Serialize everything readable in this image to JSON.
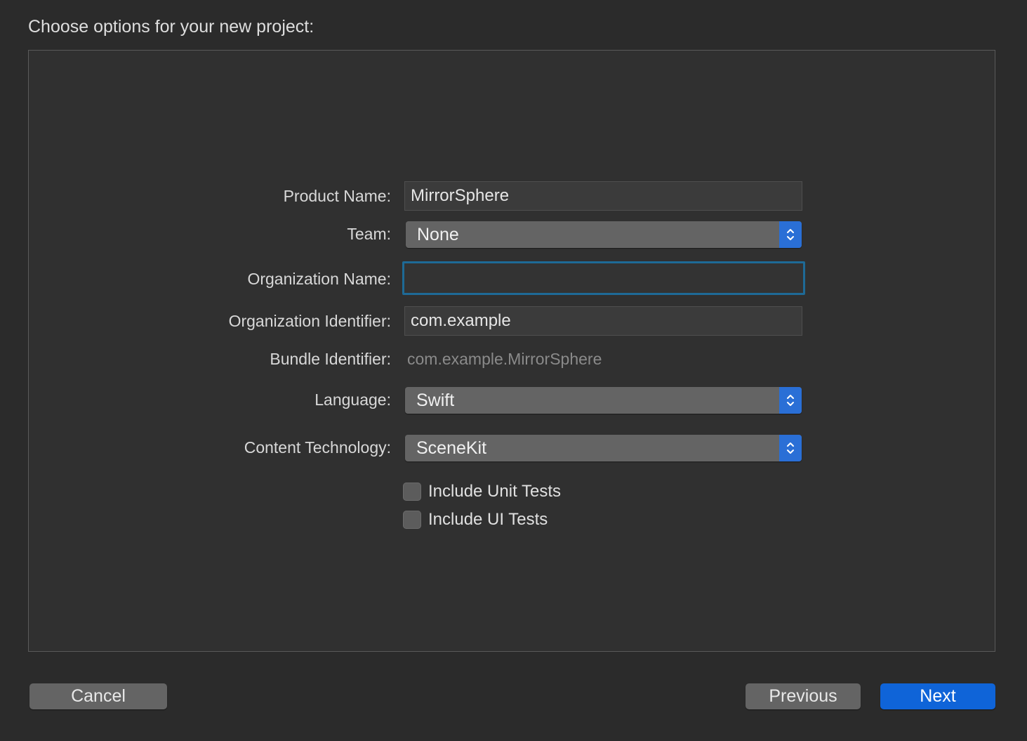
{
  "heading": "Choose options for your new project:",
  "form": {
    "product_name": {
      "label": "Product Name:",
      "value": "MirrorSphere"
    },
    "team": {
      "label": "Team:",
      "selected": "None"
    },
    "organization_name": {
      "label": "Organization Name:",
      "value": ""
    },
    "organization_identifier": {
      "label": "Organization Identifier:",
      "value": "com.example"
    },
    "bundle_identifier": {
      "label": "Bundle Identifier:",
      "value": "com.example.MirrorSphere"
    },
    "language": {
      "label": "Language:",
      "selected": "Swift"
    },
    "content_technology": {
      "label": "Content Technology:",
      "selected": "SceneKit"
    },
    "include_unit_tests": {
      "label": "Include Unit Tests",
      "checked": false
    },
    "include_ui_tests": {
      "label": "Include UI Tests",
      "checked": false
    }
  },
  "buttons": {
    "cancel": "Cancel",
    "previous": "Previous",
    "next": "Next"
  },
  "colors": {
    "accent": "#0f64d8",
    "focus_ring": "#1e6a96",
    "background": "#2b2b2b"
  },
  "icons": {
    "popup_stepper": "chevron-up-down-icon"
  }
}
